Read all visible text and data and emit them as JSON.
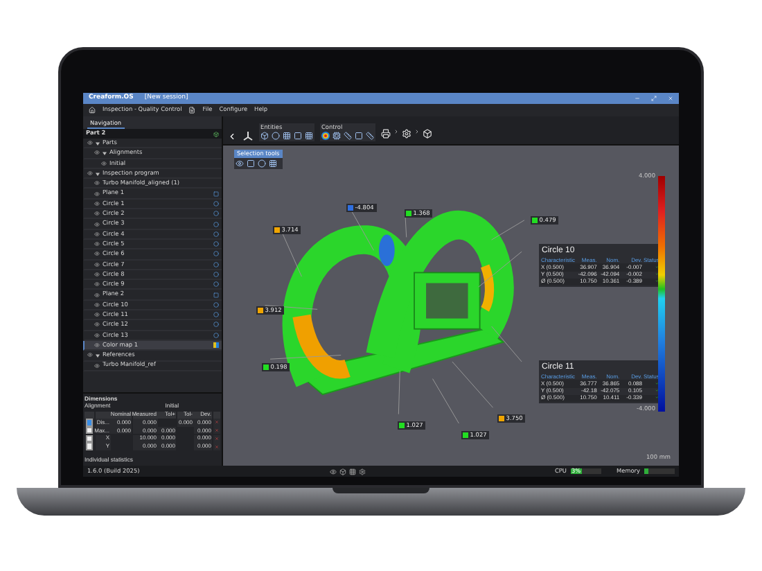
{
  "window": {
    "title": "Creaform.OS",
    "session": "[New session]"
  },
  "breadcrumb": "Inspection - Quality Control",
  "menu": [
    "File",
    "Configure",
    "Help"
  ],
  "toolbar_groups": [
    {
      "label": "Entities"
    },
    {
      "label": "Control"
    }
  ],
  "navigation": {
    "tab": "Navigation",
    "part": "Part 2",
    "tree": [
      {
        "label": "Parts",
        "expanded": true,
        "children": [
          {
            "label": "Alignments",
            "expanded": true,
            "children": [
              {
                "label": "Initial",
                "selected": false
              }
            ]
          }
        ]
      },
      {
        "label": "Inspection program",
        "expanded": true,
        "children": [
          {
            "label": "Turbo Manifold_aligned (1)",
            "selected": false
          },
          {
            "label": "Plane 1",
            "kind": "plane",
            "selected": false
          },
          {
            "label": "Circle 1",
            "kind": "circle",
            "selected": false
          },
          {
            "label": "Circle 2",
            "kind": "circle",
            "selected": false
          },
          {
            "label": "Circle 3",
            "kind": "circle",
            "selected": false
          },
          {
            "label": "Circle 4",
            "kind": "circle",
            "selected": false
          },
          {
            "label": "Circle 5",
            "kind": "circle",
            "selected": false
          },
          {
            "label": "Circle 6",
            "kind": "circle",
            "selected": false
          },
          {
            "label": "Circle 7",
            "kind": "circle",
            "selected": false
          },
          {
            "label": "Circle 8",
            "kind": "circle",
            "selected": false
          },
          {
            "label": "Circle 9",
            "kind": "circle",
            "selected": false
          },
          {
            "label": "Plane 2",
            "kind": "plane",
            "selected": false
          },
          {
            "label": "Circle 10",
            "kind": "circle",
            "selected": false
          },
          {
            "label": "Circle 11",
            "kind": "circle",
            "selected": false
          },
          {
            "label": "Circle 12",
            "kind": "circle",
            "selected": false
          },
          {
            "label": "Circle 13",
            "kind": "circle",
            "selected": false
          },
          {
            "label": "Color map 1",
            "kind": "colormap",
            "selected": true
          }
        ]
      },
      {
        "label": "References",
        "expanded": true,
        "children": [
          {
            "label": "Turbo Manifold_ref",
            "selected": false
          }
        ]
      }
    ]
  },
  "dimensions": {
    "title": "Dimensions",
    "alignment_label": "Alignment",
    "alignment": "Initial",
    "columns": [
      "Nominal",
      "Measured",
      "Tol+",
      "Tol-",
      "Dev."
    ],
    "rows": [
      {
        "name": "Dis...",
        "checked": true,
        "cells": [
          "0.000",
          "0.000",
          "",
          "0.000",
          "0.000"
        ]
      },
      {
        "name": "Max...",
        "checked": false,
        "cells": [
          "0.000",
          "0.000",
          "0.000",
          "",
          "0.000"
        ]
      },
      {
        "name": "X",
        "checked": false,
        "cells": [
          "",
          "10.000",
          "0.000",
          "",
          "0.000"
        ]
      },
      {
        "name": "Y",
        "checked": false,
        "cells": [
          "",
          "0.000",
          "0.000",
          "",
          "0.000"
        ]
      }
    ],
    "footer": "Individual statistics"
  },
  "selection_tools": {
    "title": "Selection tools"
  },
  "callouts": [
    {
      "value": "-4.804",
      "color": "#2f6fe0"
    },
    {
      "value": "1.368",
      "color": "#22dd22"
    },
    {
      "value": "0.479",
      "color": "#22dd22"
    },
    {
      "value": "3.714",
      "color": "#f0a500"
    },
    {
      "value": "3.912",
      "color": "#f0a500"
    },
    {
      "value": "0.198",
      "color": "#22dd22"
    },
    {
      "value": "1.027",
      "color": "#22dd22"
    },
    {
      "value": "1.027",
      "color": "#22dd22"
    },
    {
      "value": "3.750",
      "color": "#f0a500"
    }
  ],
  "circle_tables": [
    {
      "title": "Circle 10",
      "columns": [
        "Characteristic",
        "Meas.",
        "Nom.",
        "Dev.",
        "Status"
      ],
      "rows": [
        [
          "X (0.500)",
          "36.907",
          "36.904",
          "-0.007"
        ],
        [
          "Y (0.500)",
          "-42.096",
          "-42.094",
          "-0.002"
        ],
        [
          "Ø (0.500)",
          "10.750",
          "10.361",
          "-0.389"
        ]
      ]
    },
    {
      "title": "Circle 11",
      "columns": [
        "Characteristic",
        "Meas.",
        "Nom.",
        "Dev.",
        "Status"
      ],
      "rows": [
        [
          "X (0.500)",
          "36.777",
          "36.865",
          "0.088"
        ],
        [
          "Y (0.500)",
          "-42.18",
          "-42.075",
          "0.105"
        ],
        [
          "Ø (0.500)",
          "10.750",
          "10.411",
          "-0.339"
        ]
      ]
    }
  ],
  "legend": {
    "max": "4.000",
    "min": "-4.000"
  },
  "scale": "100 mm",
  "status": {
    "version": "1.6.0 (Build 2025)",
    "cpu": {
      "label": "CPU",
      "reading": "3%",
      "level": 0.35
    },
    "memory": {
      "label": "Memory",
      "level": 0.12
    }
  }
}
